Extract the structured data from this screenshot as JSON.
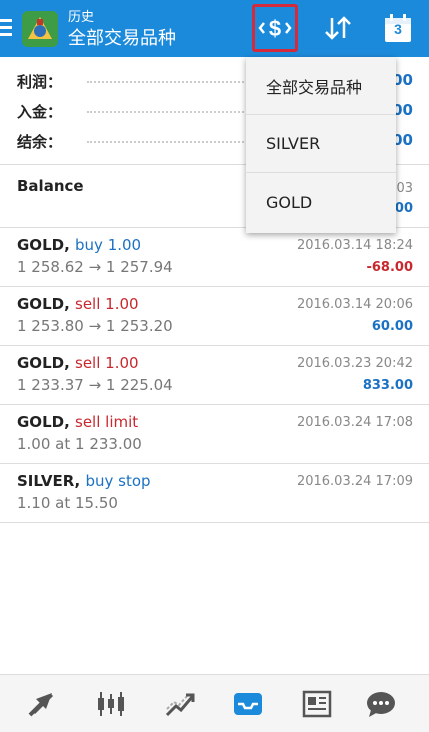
{
  "header": {
    "subtitle": "历史",
    "title": "全部交易品种",
    "calendar_day": "3",
    "accent_color": "#1c8adb",
    "highlight_color": "#d42a3a"
  },
  "summary": {
    "rows": [
      {
        "label": "利润：",
        "value": "00"
      },
      {
        "label": "入金：",
        "value": "00"
      },
      {
        "label": "结余：",
        "value": "00"
      }
    ]
  },
  "balance": {
    "label": "Balance",
    "time": ":03",
    "value": ".00"
  },
  "orders": [
    {
      "symbol": "GOLD,",
      "action": "buy 1.00",
      "side": "buy",
      "price": "1 258.62 → 1 257.94",
      "time": "2016.03.14 18:24",
      "profit": "-68.00"
    },
    {
      "symbol": "GOLD,",
      "action": "sell 1.00",
      "side": "sell",
      "price": "1 253.80 → 1 253.20",
      "time": "2016.03.14 20:06",
      "profit": "60.00"
    },
    {
      "symbol": "GOLD,",
      "action": "sell 1.00",
      "side": "sell",
      "price": "1 233.37 → 1 225.04",
      "time": "2016.03.23 20:42",
      "profit": "833.00"
    },
    {
      "symbol": "GOLD,",
      "action": "sell limit",
      "side": "sell",
      "price": "1.00 at 1 233.00",
      "time": "2016.03.24 17:08",
      "profit": ""
    },
    {
      "symbol": "SILVER,",
      "action": "buy stop",
      "side": "buy",
      "price": "1.10 at 15.50",
      "time": "2016.03.24 17:09",
      "profit": ""
    }
  ],
  "dropdown": {
    "items": [
      "全部交易品种",
      "SILVER",
      "GOLD"
    ]
  },
  "bottom_nav": [
    "quotes-icon",
    "chart-icon",
    "trade-icon",
    "history-icon",
    "news-icon",
    "chat-icon"
  ]
}
